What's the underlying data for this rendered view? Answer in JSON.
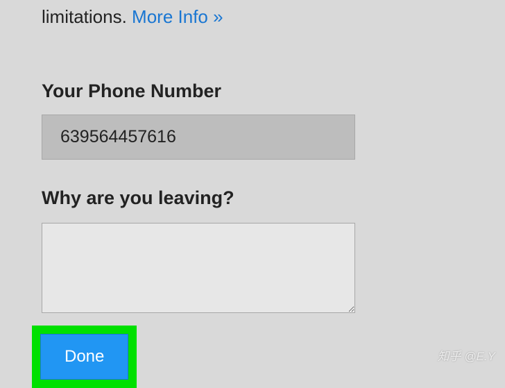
{
  "intro": {
    "prefix": "limitations. ",
    "linkText": "More Info »"
  },
  "fields": {
    "phone": {
      "label": "Your Phone Number",
      "value": "639564457616"
    },
    "reason": {
      "label": "Why are you leaving?",
      "value": ""
    }
  },
  "buttons": {
    "done": "Done"
  },
  "watermark": "知乎 @E.Y"
}
